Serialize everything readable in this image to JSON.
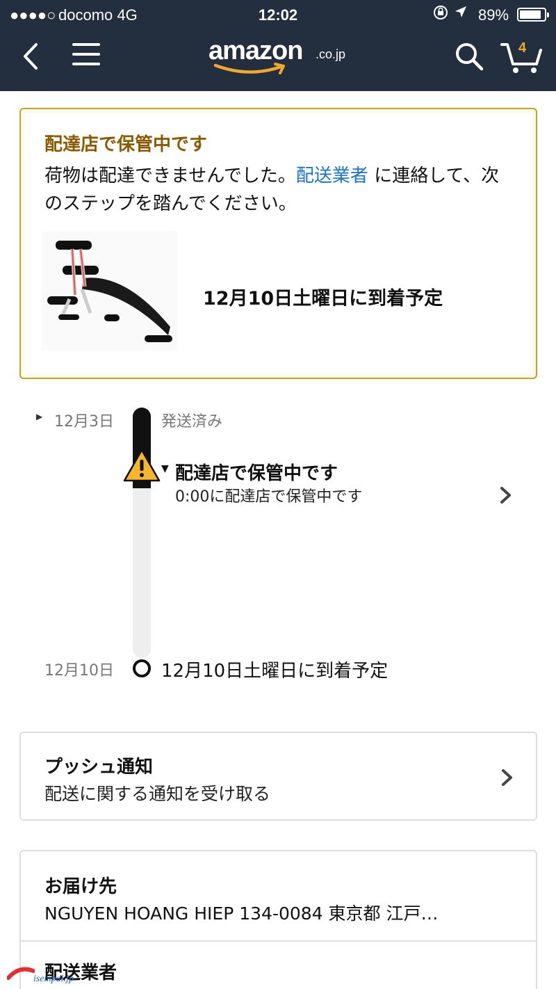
{
  "status_bar": {
    "signal": "●●●●○",
    "carrier": "docomo   4G",
    "time": "12:02",
    "battery_percent": "89%",
    "battery_level": 0.89
  },
  "nav": {
    "logo_text": "amazon",
    "logo_tld": ".co.jp",
    "cart_count": "4",
    "colors": {
      "bar": "#232f3e",
      "smile": "#f0a830"
    }
  },
  "alert": {
    "title": "配達店で保管中です",
    "body_before_link": "荷物は配達できませんでした。",
    "link_text": "配送業者",
    "body_after_link": " に連絡して、次のステップを踏んでください。",
    "arrival_text": "12月10日土曜日に到着予定",
    "colors": {
      "title": "#8a5a00",
      "border": "#c89d2a",
      "link": "#1a73c8"
    }
  },
  "timeline": {
    "start_date": "12月3日",
    "start_label": "発送済み",
    "current_status": "配達店で保管中です",
    "current_detail": "0:00に配達店で保管中です",
    "end_date": "12月10日",
    "end_label": "12月10日土曜日に到着予定"
  },
  "push_notification": {
    "title": "プッシュ通知",
    "subtitle": "配送に関する通知を受け取る"
  },
  "delivery_address": {
    "title": "お届け先",
    "value": "NGUYEN HOANG HIEP 134-0084 東京都 江戸…"
  },
  "carrier_section": {
    "title": "配送業者"
  },
  "watermark": {
    "text": "isempai.jp"
  }
}
